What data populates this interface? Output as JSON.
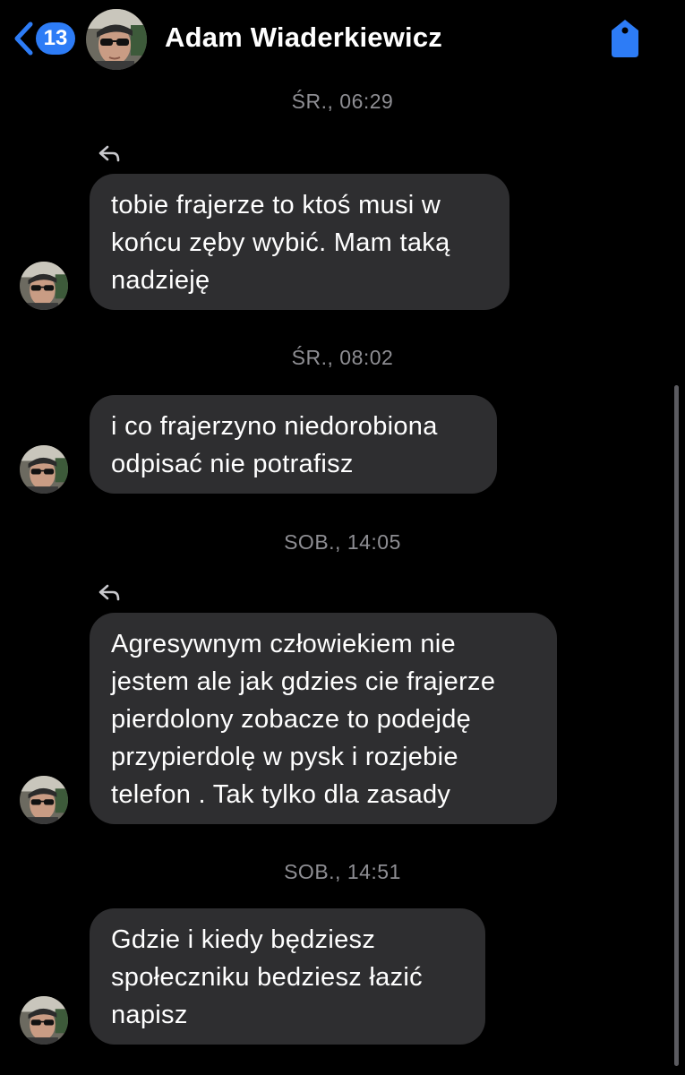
{
  "header": {
    "back_count": "13",
    "contact_name": "Adam Wiaderkiewicz"
  },
  "colors": {
    "accent": "#2d7cf6",
    "bubble": "#2e2e30",
    "timestamp": "#8e8e93",
    "background": "#000000"
  },
  "messages": [
    {
      "timestamp": "ŚR., 06:29",
      "reply": true,
      "lines": [
        "tobie frajerze to ktoś musi w",
        "końcu zęby wybić. Mam taką",
        "nadzieję"
      ]
    },
    {
      "timestamp": "ŚR., 08:02",
      "reply": false,
      "lines": [
        "i co frajerzyno niedorobiona",
        "odpisać nie potrafisz"
      ]
    },
    {
      "timestamp": "SOB., 14:05",
      "reply": true,
      "lines": [
        "Agresywnym człowiekiem nie",
        "jestem ale jak gdzies cie frajerze",
        "pierdolony zobacze to podejdę",
        "przypierdolę w pysk i rozjebie",
        "telefon . Tak tylko dla zasady"
      ]
    },
    {
      "timestamp": "SOB., 14:51",
      "reply": false,
      "lines": [
        "Gdzie i kiedy będziesz",
        "społeczniku bedziesz łazić",
        "napisz"
      ]
    }
  ]
}
